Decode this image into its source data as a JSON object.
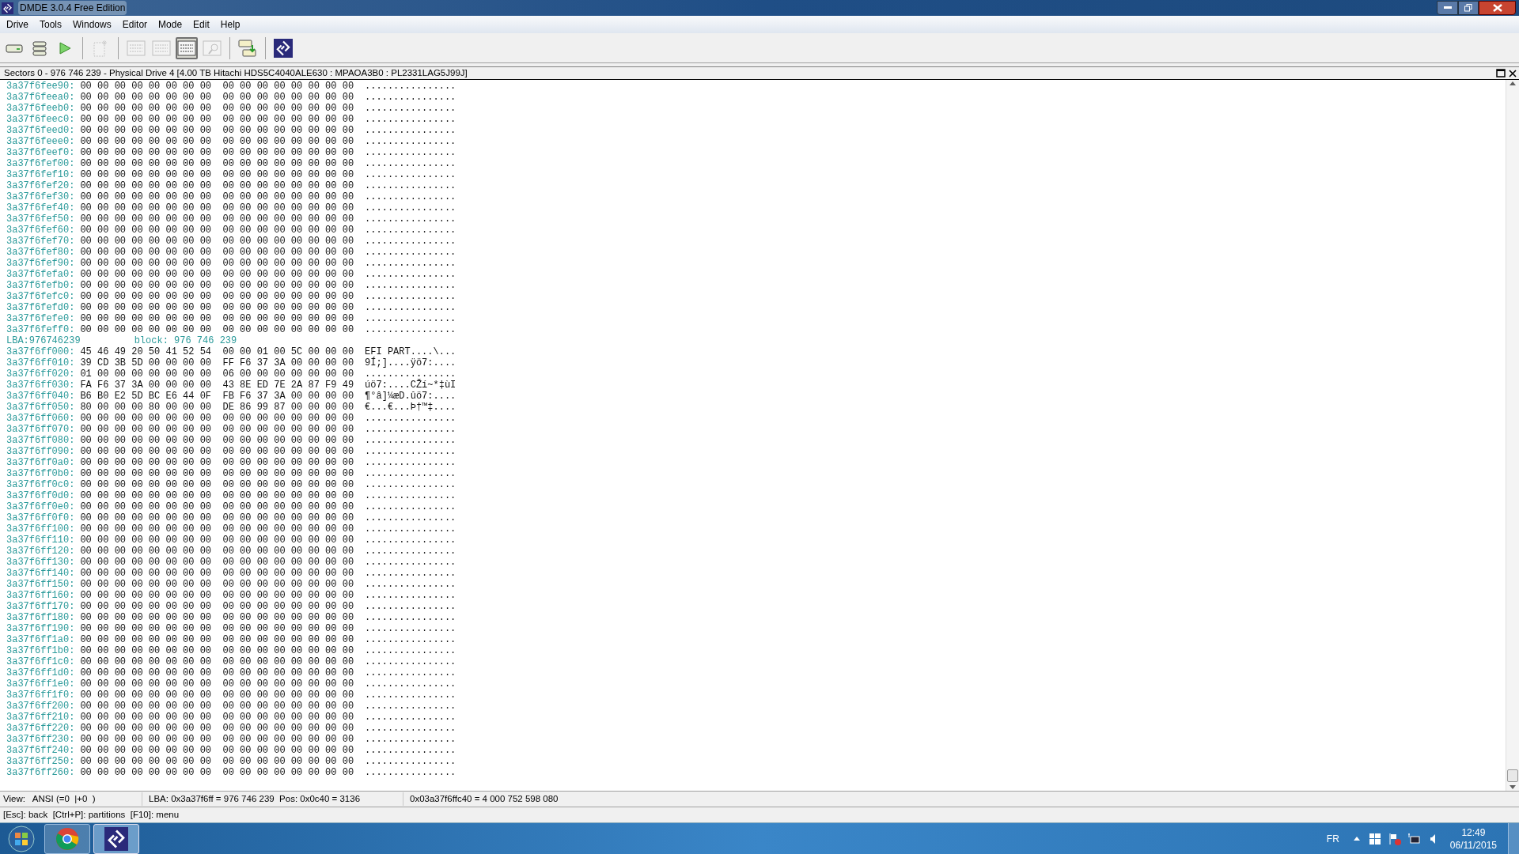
{
  "window": {
    "title": "DMDE 3.0.4 Free Edition"
  },
  "menu": [
    "Drive",
    "Tools",
    "Windows",
    "Editor",
    "Mode",
    "Edit",
    "Help"
  ],
  "toolbar": [
    {
      "kind": "drive",
      "disabled": false,
      "selected": false
    },
    {
      "kind": "stack",
      "disabled": false,
      "selected": false
    },
    {
      "kind": "play",
      "disabled": false,
      "selected": false
    },
    {
      "kind": "sep"
    },
    {
      "kind": "newdoc",
      "disabled": true,
      "selected": false
    },
    {
      "kind": "sep"
    },
    {
      "kind": "tree",
      "disabled": true,
      "selected": false
    },
    {
      "kind": "list",
      "disabled": true,
      "selected": false
    },
    {
      "kind": "hex",
      "disabled": false,
      "selected": true
    },
    {
      "kind": "find",
      "disabled": true,
      "selected": false
    },
    {
      "kind": "sep"
    },
    {
      "kind": "copy",
      "disabled": false,
      "selected": false
    },
    {
      "kind": "sep"
    },
    {
      "kind": "logo",
      "disabled": false,
      "selected": false
    }
  ],
  "panel": {
    "title": "Sectors 0 - 976 746 239 - Physical Drive 4 [4.00 TB Hitachi HDS5C4040ALE630 : MPAOA3B0 : PL2331LAG5J99J]",
    "rows": [
      {
        "kind": "data",
        "address": "3a37f6fee90:",
        "hex": "00 00 00 00 00 00 00 00  00 00 00 00 00 00 00 00",
        "ascii": "................"
      },
      {
        "kind": "data",
        "address": "3a37f6feea0:",
        "hex": "00 00 00 00 00 00 00 00  00 00 00 00 00 00 00 00",
        "ascii": "................"
      },
      {
        "kind": "data",
        "address": "3a37f6feeb0:",
        "hex": "00 00 00 00 00 00 00 00  00 00 00 00 00 00 00 00",
        "ascii": "................"
      },
      {
        "kind": "data",
        "address": "3a37f6feec0:",
        "hex": "00 00 00 00 00 00 00 00  00 00 00 00 00 00 00 00",
        "ascii": "................"
      },
      {
        "kind": "data",
        "address": "3a37f6feed0:",
        "hex": "00 00 00 00 00 00 00 00  00 00 00 00 00 00 00 00",
        "ascii": "................"
      },
      {
        "kind": "data",
        "address": "3a37f6feee0:",
        "hex": "00 00 00 00 00 00 00 00  00 00 00 00 00 00 00 00",
        "ascii": "................"
      },
      {
        "kind": "data",
        "address": "3a37f6feef0:",
        "hex": "00 00 00 00 00 00 00 00  00 00 00 00 00 00 00 00",
        "ascii": "................"
      },
      {
        "kind": "data",
        "address": "3a37f6fef00:",
        "hex": "00 00 00 00 00 00 00 00  00 00 00 00 00 00 00 00",
        "ascii": "................"
      },
      {
        "kind": "data",
        "address": "3a37f6fef10:",
        "hex": "00 00 00 00 00 00 00 00  00 00 00 00 00 00 00 00",
        "ascii": "................"
      },
      {
        "kind": "data",
        "address": "3a37f6fef20:",
        "hex": "00 00 00 00 00 00 00 00  00 00 00 00 00 00 00 00",
        "ascii": "................"
      },
      {
        "kind": "data",
        "address": "3a37f6fef30:",
        "hex": "00 00 00 00 00 00 00 00  00 00 00 00 00 00 00 00",
        "ascii": "................"
      },
      {
        "kind": "data",
        "address": "3a37f6fef40:",
        "hex": "00 00 00 00 00 00 00 00  00 00 00 00 00 00 00 00",
        "ascii": "................"
      },
      {
        "kind": "data",
        "address": "3a37f6fef50:",
        "hex": "00 00 00 00 00 00 00 00  00 00 00 00 00 00 00 00",
        "ascii": "................"
      },
      {
        "kind": "data",
        "address": "3a37f6fef60:",
        "hex": "00 00 00 00 00 00 00 00  00 00 00 00 00 00 00 00",
        "ascii": "................"
      },
      {
        "kind": "data",
        "address": "3a37f6fef70:",
        "hex": "00 00 00 00 00 00 00 00  00 00 00 00 00 00 00 00",
        "ascii": "................"
      },
      {
        "kind": "data",
        "address": "3a37f6fef80:",
        "hex": "00 00 00 00 00 00 00 00  00 00 00 00 00 00 00 00",
        "ascii": "................"
      },
      {
        "kind": "data",
        "address": "3a37f6fef90:",
        "hex": "00 00 00 00 00 00 00 00  00 00 00 00 00 00 00 00",
        "ascii": "................"
      },
      {
        "kind": "data",
        "address": "3a37f6fefa0:",
        "hex": "00 00 00 00 00 00 00 00  00 00 00 00 00 00 00 00",
        "ascii": "................"
      },
      {
        "kind": "data",
        "address": "3a37f6fefb0:",
        "hex": "00 00 00 00 00 00 00 00  00 00 00 00 00 00 00 00",
        "ascii": "................"
      },
      {
        "kind": "data",
        "address": "3a37f6fefc0:",
        "hex": "00 00 00 00 00 00 00 00  00 00 00 00 00 00 00 00",
        "ascii": "................"
      },
      {
        "kind": "data",
        "address": "3a37f6fefd0:",
        "hex": "00 00 00 00 00 00 00 00  00 00 00 00 00 00 00 00",
        "ascii": "................"
      },
      {
        "kind": "data",
        "address": "3a37f6fefe0:",
        "hex": "00 00 00 00 00 00 00 00  00 00 00 00 00 00 00 00",
        "ascii": "................"
      },
      {
        "kind": "data",
        "address": "3a37f6feff0:",
        "hex": "00 00 00 00 00 00 00 00  00 00 00 00 00 00 00 00",
        "ascii": "................"
      },
      {
        "kind": "lba",
        "lba": "LBA:976746239",
        "block": "block: 976 746 239"
      },
      {
        "kind": "data",
        "address": "3a37f6ff000:",
        "hex": "45 46 49 20 50 41 52 54  00 00 01 00 5C 00 00 00",
        "ascii": "EFI PART....\\..."
      },
      {
        "kind": "data",
        "address": "3a37f6ff010:",
        "hex": "39 CD 3B 5D 00 00 00 00  FF F6 37 3A 00 00 00 00",
        "ascii": "9Í;]....ÿö7:...."
      },
      {
        "kind": "data",
        "address": "3a37f6ff020:",
        "hex": "01 00 00 00 00 00 00 00  06 00 00 00 00 00 00 00",
        "ascii": "................"
      },
      {
        "kind": "data",
        "address": "3a37f6ff030:",
        "hex": "FA F6 37 3A 00 00 00 00  43 8E ED 7E 2A 87 F9 49",
        "ascii": "úö7:....CŽí~*‡ùI"
      },
      {
        "kind": "data",
        "address": "3a37f6ff040:",
        "hex": "B6 B0 E2 5D BC E6 44 0F  FB F6 37 3A 00 00 00 00",
        "ascii": "¶°â]¼æD.ûö7:...."
      },
      {
        "kind": "data",
        "address": "3a37f6ff050:",
        "hex": "80 00 00 00 80 00 00 00  DE 86 99 87 00 00 00 00",
        "ascii": "€...€...Þ†™‡...."
      },
      {
        "kind": "data",
        "address": "3a37f6ff060:",
        "hex": "00 00 00 00 00 00 00 00  00 00 00 00 00 00 00 00",
        "ascii": "................"
      },
      {
        "kind": "data",
        "address": "3a37f6ff070:",
        "hex": "00 00 00 00 00 00 00 00  00 00 00 00 00 00 00 00",
        "ascii": "................"
      },
      {
        "kind": "data",
        "address": "3a37f6ff080:",
        "hex": "00 00 00 00 00 00 00 00  00 00 00 00 00 00 00 00",
        "ascii": "................"
      },
      {
        "kind": "data",
        "address": "3a37f6ff090:",
        "hex": "00 00 00 00 00 00 00 00  00 00 00 00 00 00 00 00",
        "ascii": "................"
      },
      {
        "kind": "data",
        "address": "3a37f6ff0a0:",
        "hex": "00 00 00 00 00 00 00 00  00 00 00 00 00 00 00 00",
        "ascii": "................"
      },
      {
        "kind": "data",
        "address": "3a37f6ff0b0:",
        "hex": "00 00 00 00 00 00 00 00  00 00 00 00 00 00 00 00",
        "ascii": "................"
      },
      {
        "kind": "data",
        "address": "3a37f6ff0c0:",
        "hex": "00 00 00 00 00 00 00 00  00 00 00 00 00 00 00 00",
        "ascii": "................"
      },
      {
        "kind": "data",
        "address": "3a37f6ff0d0:",
        "hex": "00 00 00 00 00 00 00 00  00 00 00 00 00 00 00 00",
        "ascii": "................"
      },
      {
        "kind": "data",
        "address": "3a37f6ff0e0:",
        "hex": "00 00 00 00 00 00 00 00  00 00 00 00 00 00 00 00",
        "ascii": "................"
      },
      {
        "kind": "data",
        "address": "3a37f6ff0f0:",
        "hex": "00 00 00 00 00 00 00 00  00 00 00 00 00 00 00 00",
        "ascii": "................"
      },
      {
        "kind": "data",
        "address": "3a37f6ff100:",
        "hex": "00 00 00 00 00 00 00 00  00 00 00 00 00 00 00 00",
        "ascii": "................"
      },
      {
        "kind": "data",
        "address": "3a37f6ff110:",
        "hex": "00 00 00 00 00 00 00 00  00 00 00 00 00 00 00 00",
        "ascii": "................"
      },
      {
        "kind": "data",
        "address": "3a37f6ff120:",
        "hex": "00 00 00 00 00 00 00 00  00 00 00 00 00 00 00 00",
        "ascii": "................"
      },
      {
        "kind": "data",
        "address": "3a37f6ff130:",
        "hex": "00 00 00 00 00 00 00 00  00 00 00 00 00 00 00 00",
        "ascii": "................"
      },
      {
        "kind": "data",
        "address": "3a37f6ff140:",
        "hex": "00 00 00 00 00 00 00 00  00 00 00 00 00 00 00 00",
        "ascii": "................"
      },
      {
        "kind": "data",
        "address": "3a37f6ff150:",
        "hex": "00 00 00 00 00 00 00 00  00 00 00 00 00 00 00 00",
        "ascii": "................"
      },
      {
        "kind": "data",
        "address": "3a37f6ff160:",
        "hex": "00 00 00 00 00 00 00 00  00 00 00 00 00 00 00 00",
        "ascii": "................"
      },
      {
        "kind": "data",
        "address": "3a37f6ff170:",
        "hex": "00 00 00 00 00 00 00 00  00 00 00 00 00 00 00 00",
        "ascii": "................"
      },
      {
        "kind": "data",
        "address": "3a37f6ff180:",
        "hex": "00 00 00 00 00 00 00 00  00 00 00 00 00 00 00 00",
        "ascii": "................"
      },
      {
        "kind": "data",
        "address": "3a37f6ff190:",
        "hex": "00 00 00 00 00 00 00 00  00 00 00 00 00 00 00 00",
        "ascii": "................"
      },
      {
        "kind": "data",
        "address": "3a37f6ff1a0:",
        "hex": "00 00 00 00 00 00 00 00  00 00 00 00 00 00 00 00",
        "ascii": "................"
      },
      {
        "kind": "data",
        "address": "3a37f6ff1b0:",
        "hex": "00 00 00 00 00 00 00 00  00 00 00 00 00 00 00 00",
        "ascii": "................"
      },
      {
        "kind": "data",
        "address": "3a37f6ff1c0:",
        "hex": "00 00 00 00 00 00 00 00  00 00 00 00 00 00 00 00",
        "ascii": "................"
      },
      {
        "kind": "data",
        "address": "3a37f6ff1d0:",
        "hex": "00 00 00 00 00 00 00 00  00 00 00 00 00 00 00 00",
        "ascii": "................"
      },
      {
        "kind": "data",
        "address": "3a37f6ff1e0:",
        "hex": "00 00 00 00 00 00 00 00  00 00 00 00 00 00 00 00",
        "ascii": "................"
      },
      {
        "kind": "data",
        "address": "3a37f6ff1f0:",
        "hex": "00 00 00 00 00 00 00 00  00 00 00 00 00 00 00 00",
        "ascii": "................"
      },
      {
        "kind": "data",
        "address": "3a37f6ff200:",
        "hex": "00 00 00 00 00 00 00 00  00 00 00 00 00 00 00 00",
        "ascii": "................"
      },
      {
        "kind": "data",
        "address": "3a37f6ff210:",
        "hex": "00 00 00 00 00 00 00 00  00 00 00 00 00 00 00 00",
        "ascii": "................"
      },
      {
        "kind": "data",
        "address": "3a37f6ff220:",
        "hex": "00 00 00 00 00 00 00 00  00 00 00 00 00 00 00 00",
        "ascii": "................"
      },
      {
        "kind": "data",
        "address": "3a37f6ff230:",
        "hex": "00 00 00 00 00 00 00 00  00 00 00 00 00 00 00 00",
        "ascii": "................"
      },
      {
        "kind": "data",
        "address": "3a37f6ff240:",
        "hex": "00 00 00 00 00 00 00 00  00 00 00 00 00 00 00 00",
        "ascii": "................"
      },
      {
        "kind": "data",
        "address": "3a37f6ff250:",
        "hex": "00 00 00 00 00 00 00 00  00 00 00 00 00 00 00 00",
        "ascii": "................"
      },
      {
        "kind": "data",
        "address": "3a37f6ff260:",
        "hex": "00 00 00 00 00 00 00 00  00 00 00 00 00 00 00 00",
        "ascii": "................"
      }
    ]
  },
  "status_bar": {
    "view": "View:   ANSI (=0  |+0  )",
    "position": "LBA: 0x3a37f6ff = 976 746 239  Pos: 0x0c40 = 3136",
    "offset": "0x03a37f6ffc40 = 4 000 752 598 080"
  },
  "hint_bar": "[Esc]: back  [Ctrl+P]: partitions  [F10]: menu",
  "taskbar": {
    "apps": [
      {
        "kind": "chrome",
        "selected": false
      },
      {
        "kind": "dmde",
        "selected": true
      }
    ],
    "language": "FR",
    "time": "12:49",
    "date": "06/11/2015"
  }
}
